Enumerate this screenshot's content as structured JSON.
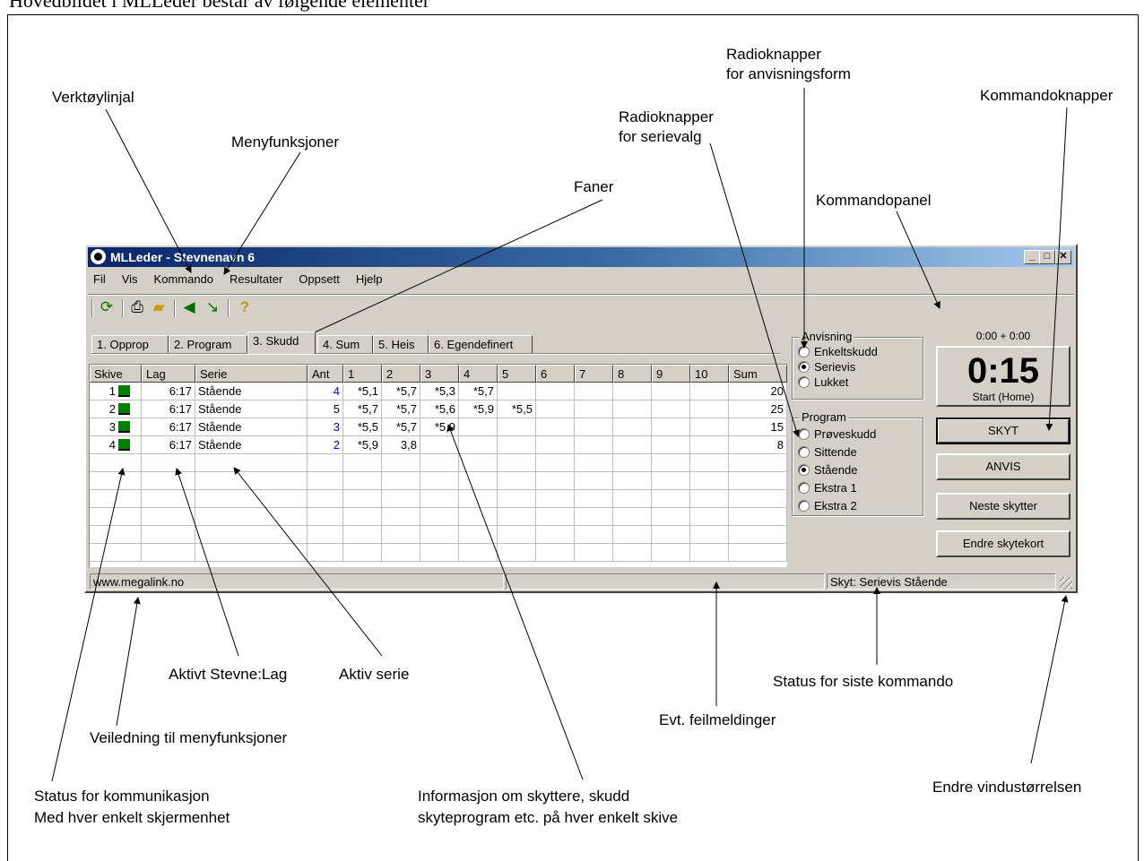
{
  "heading": "Hovedbildet i MLLeder består av følgende elementer",
  "window": {
    "title": "MLLeder - Stevnenavn 6",
    "controls": [
      "_",
      "□",
      "✕"
    ]
  },
  "menu": [
    "Fil",
    "Vis",
    "Kommando",
    "Resultater",
    "Oppsett",
    "Hjelp"
  ],
  "toolbar_icons": [
    "refresh-icon",
    "print-icon",
    "open-folder-icon",
    "speaker-icon",
    "transmit-icon",
    "help-icon"
  ],
  "tabs": [
    "1. Opprop",
    "2. Program",
    "3. Skudd",
    "4. Sum",
    "5. Heis",
    "6. Egendefinert"
  ],
  "active_tab": "3. Skudd",
  "grid": {
    "columns": [
      "Skive",
      "Lag",
      "Serie",
      "Ant",
      "1",
      "2",
      "3",
      "4",
      "5",
      "6",
      "7",
      "8",
      "9",
      "10",
      "Sum"
    ],
    "rows": [
      {
        "skive": "1",
        "lag": "6:17",
        "serie": "Stående",
        "ant": "4",
        "shots": [
          "*5,1",
          "*5,7",
          "*5,3",
          "*5,7",
          "",
          "",
          "",
          "",
          "",
          ""
        ],
        "sum": "20"
      },
      {
        "skive": "2",
        "lag": "6:17",
        "serie": "Stående",
        "ant": "5",
        "shots": [
          "*5,7",
          "*5,7",
          "*5,6",
          "*5,9",
          "*5,5",
          "",
          "",
          "",
          "",
          ""
        ],
        "sum": "25"
      },
      {
        "skive": "3",
        "lag": "6:17",
        "serie": "Stående",
        "ant": "3",
        "shots": [
          "*5,5",
          "*5,7",
          "*5,9",
          "",
          "",
          "",
          "",
          "",
          "",
          ""
        ],
        "sum": "15"
      },
      {
        "skive": "4",
        "lag": "6:17",
        "serie": "Stående",
        "ant": "2",
        "shots": [
          "*5,9",
          "3,8",
          "",
          "",
          "",
          "",
          "",
          "",
          "",
          ""
        ],
        "sum": "8"
      }
    ]
  },
  "anvisning": {
    "title": "Anvisning",
    "options": [
      "Enkeltskudd",
      "Serievis",
      "Lukket"
    ],
    "selected": "Serievis"
  },
  "program": {
    "title": "Program",
    "options": [
      "Prøveskudd",
      "Sittende",
      "Stående",
      "Ekstra 1",
      "Ekstra 2"
    ],
    "selected": "Stående"
  },
  "timer": {
    "small": "0:00 +  0:00",
    "big": "0:15",
    "sub": "Start (Home)"
  },
  "buttons": [
    "SKYT",
    "ANVIS",
    "Neste skytter",
    "Endre skytekort"
  ],
  "status": {
    "left": "www.megalink.no",
    "middle": "",
    "right": "Skyt: Serievis Stående"
  },
  "annotations": {
    "verktoylinjal": "Verktøylinjal",
    "menyfunksjoner": "Menyfunksjoner",
    "faner": "Faner",
    "radio_serie_1": "Radioknapper",
    "radio_serie_2": "for serievalg",
    "radio_anvis_1": "Radioknapper",
    "radio_anvis_2": "for anvisningsform",
    "kommandopanel": "Kommandopanel",
    "kommandoknapper": "Kommandoknapper",
    "aktivt_stevne": "Aktivt Stevne:Lag",
    "aktiv_serie": "Aktiv serie",
    "veiledning": "Veiledning til menyfunksjoner",
    "status_komm_1": "Status for kommunikasjon",
    "status_komm_2": "Med hver enkelt skjermenhet",
    "informasjon_1": "Informasjon om skyttere, skudd",
    "informasjon_2": "skyteprogram etc. på hver enkelt skive",
    "feilmeldinger": "Evt. feilmeldinger",
    "status_siste": "Status for siste kommando",
    "endre_vindu": "Endre vindustørrelsen"
  }
}
